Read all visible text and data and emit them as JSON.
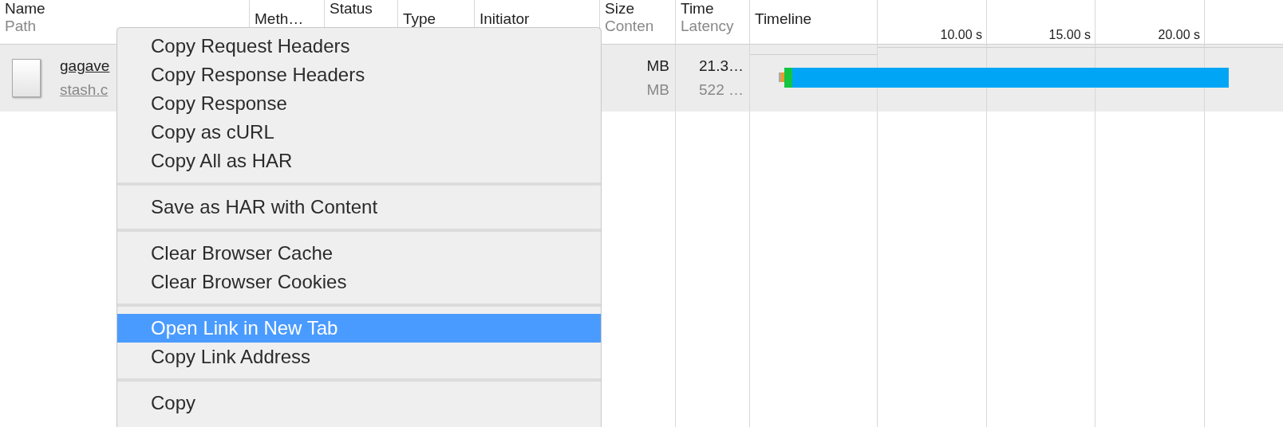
{
  "columns": [
    {
      "title": "Name",
      "subtitle": "Path",
      "kind": "double"
    },
    {
      "title": "Meth…",
      "kind": "single"
    },
    {
      "title": "Status",
      "kind": "top"
    },
    {
      "title": "Type",
      "kind": "single"
    },
    {
      "title": "Initiator",
      "kind": "single"
    },
    {
      "title": "Size",
      "subtitle": "Conten",
      "kind": "double"
    },
    {
      "title": "Time",
      "subtitle": "Latency",
      "kind": "double"
    },
    {
      "title": "Timeline",
      "kind": "timeline"
    }
  ],
  "timeline_ticks": [
    "10.00 s",
    "15.00 s",
    "20.00 s"
  ],
  "request": {
    "name": "gagave",
    "path": "stash.c",
    "size": "MB",
    "content": "MB",
    "time": "21.3…",
    "latency": "522 …",
    "selected": true
  },
  "context_menu": {
    "groups": [
      [
        {
          "label": "Copy Request Headers",
          "selected": false
        },
        {
          "label": "Copy Response Headers",
          "selected": false
        },
        {
          "label": "Copy Response",
          "selected": false
        },
        {
          "label": "Copy as cURL",
          "selected": false
        },
        {
          "label": "Copy All as HAR",
          "selected": false
        }
      ],
      [
        {
          "label": "Save as HAR with Content",
          "selected": false
        }
      ],
      [
        {
          "label": "Clear Browser Cache",
          "selected": false
        },
        {
          "label": "Clear Browser Cookies",
          "selected": false
        }
      ],
      [
        {
          "label": "Open Link in New Tab",
          "selected": true
        },
        {
          "label": "Copy Link Address",
          "selected": false
        }
      ],
      [
        {
          "label": "Copy",
          "selected": false
        }
      ]
    ]
  }
}
